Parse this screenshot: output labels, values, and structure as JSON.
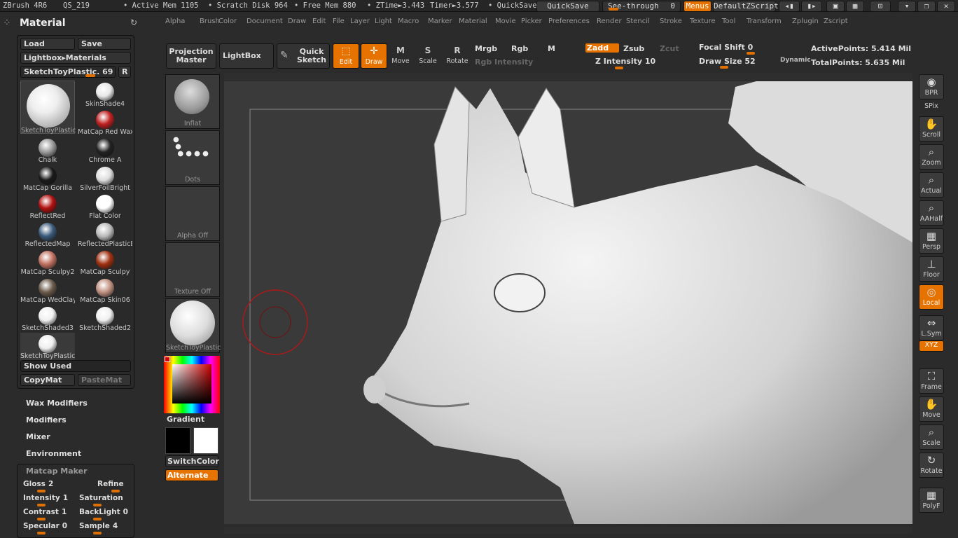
{
  "titlebar": {
    "app": "ZBrush 4R6",
    "doc": "QS_219",
    "active_mem": "• Active Mem 1105",
    "scratch_disk": "• Scratch Disk 964",
    "free_mem": "• Free Mem 880",
    "ztime": "• ZTime►3.443",
    "timer": "Timer►3.577",
    "quicksave_label": "• QuickSave",
    "quicksave_btn": "QuickSave",
    "see_through": "See-through",
    "see_through_val": "0",
    "menus": "Menus",
    "default_zscript": "DefaultZScript"
  },
  "menus": [
    "Alpha",
    "Brush",
    "Color",
    "Document",
    "Draw",
    "Edit",
    "File",
    "Layer",
    "Light",
    "Macro",
    "Marker",
    "Material",
    "Movie",
    "Picker",
    "Preferences",
    "Render",
    "Stencil",
    "Stroke",
    "Texture",
    "Tool",
    "Transform",
    "Zplugin",
    "Zscript"
  ],
  "panel": {
    "title": "Material",
    "load": "Load",
    "save": "Save",
    "lightbox": "Lightbox▸Materials",
    "current": "SketchToyPlastic. 69",
    "r_btn": "R",
    "selected_label": "SketchToyPlastic",
    "materials": [
      {
        "name": "SkinShade4",
        "color": "#e8e8e8"
      },
      {
        "name": "MatCap Red Wax",
        "color": "#c02020"
      },
      {
        "name": "Chalk",
        "color": "#9a9a9a"
      },
      {
        "name": "Chrome A",
        "color": "#222222"
      },
      {
        "name": "MatCap Gorilla",
        "color": "#1a1a1a"
      },
      {
        "name": "SilverFoilBright",
        "color": "#dddddd"
      },
      {
        "name": "ReflectRed",
        "color": "#b01010"
      },
      {
        "name": "Flat Color",
        "color": "#ffffff"
      },
      {
        "name": "ReflectedMap",
        "color": "#3a5a7a"
      },
      {
        "name": "ReflectedPlasticB",
        "color": "#bbbbbb"
      },
      {
        "name": "MatCap Sculpy2",
        "color": "#c07060"
      },
      {
        "name": "MatCap Sculpy",
        "color": "#a03010"
      },
      {
        "name": "MatCap WedClay",
        "color": "#6a5a4a"
      },
      {
        "name": "MatCap Skin06",
        "color": "#c09080"
      },
      {
        "name": "SketchShaded3",
        "color": "#f0f0f0"
      },
      {
        "name": "SketchShaded2",
        "color": "#f0f0f0"
      },
      {
        "name": "SketchToyPlastic",
        "color": "#eeeeee"
      }
    ],
    "show_used": "Show Used",
    "copymat": "CopyMat",
    "pastemat": "PasteMat",
    "sections": [
      "Wax Modifiers",
      "Modifiers",
      "Mixer",
      "Environment"
    ],
    "matcap_maker": "Matcap Maker",
    "sliders": [
      {
        "name": "Gloss",
        "value": "2"
      },
      {
        "name": "Refine",
        "value": ""
      },
      {
        "name": "Intensity",
        "value": "1"
      },
      {
        "name": "Saturation",
        "value": ""
      },
      {
        "name": "Contrast",
        "value": "1"
      },
      {
        "name": "BackLight",
        "value": "0"
      },
      {
        "name": "Specular",
        "value": "0"
      },
      {
        "name": "Sample",
        "value": "4"
      }
    ]
  },
  "toolbar": {
    "projection_master": "Projection Master",
    "lightbox": "LightBox",
    "quick_sketch": "Quick Sketch",
    "edit": "Edit",
    "draw": "Draw",
    "move": "Move",
    "scale": "Scale",
    "rotate": "Rotate",
    "mrgb": "Mrgb",
    "rgb": "Rgb",
    "m": "M",
    "rgb_intensity": "Rgb Intensity",
    "zadd": "Zadd",
    "zsub": "Zsub",
    "zcut": "Zcut",
    "z_intensity": "Z Intensity 10",
    "focal_shift": "Focal Shift 0",
    "draw_size": "Draw Size 52",
    "dynamic": "Dynamic",
    "active_points": "ActivePoints: 5.414 Mil",
    "total_points": "TotalPoints: 5.635 Mil"
  },
  "left_tools": {
    "brush": "Inflat",
    "stroke": "Dots",
    "alpha": "Alpha Off",
    "texture": "Texture Off",
    "material": "SketchToyPlastic",
    "gradient": "Gradient",
    "switchcolor": "SwitchColor",
    "alternate": "Alternate"
  },
  "right_tools": [
    {
      "label": "BPR",
      "icon": "sphere-icon"
    },
    {
      "label": "SPix",
      "icon": "slider-icon"
    },
    {
      "label": "Scroll",
      "icon": "hand-icon"
    },
    {
      "label": "Zoom",
      "icon": "magnifier-icon"
    },
    {
      "label": "Actual",
      "icon": "magnifier-icon"
    },
    {
      "label": "AAHalf",
      "icon": "magnifier-icon"
    },
    {
      "label": "Persp",
      "icon": "grid-icon"
    },
    {
      "label": "Floor",
      "icon": "floor-icon"
    },
    {
      "label": "Local",
      "icon": "local-icon"
    },
    {
      "label": "L.Sym",
      "icon": "sym-icon"
    },
    {
      "label": "XYZ",
      "icon": "xyz-icon"
    },
    {
      "label": "Frame",
      "icon": "frame-icon"
    },
    {
      "label": "Move",
      "icon": "hand-icon"
    },
    {
      "label": "Scale",
      "icon": "magnifier-icon"
    },
    {
      "label": "Rotate",
      "icon": "rotate-icon"
    },
    {
      "label": "PolyF",
      "icon": "grid-icon"
    }
  ],
  "colors": {
    "accent": "#e67200",
    "panel_bg": "#2a2a2a",
    "viewport_bg": "#3a3a3a",
    "cursor": "#c02020"
  }
}
